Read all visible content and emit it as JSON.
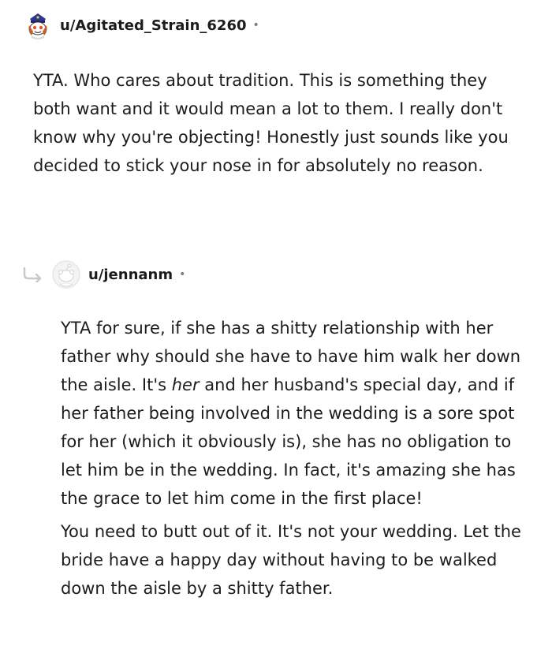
{
  "comments": [
    {
      "username": "u/Agitated_Strain_6260",
      "separator": "•",
      "paragraphs": [
        "YTA. Who cares about tradition. This is something they both want and it would mean a lot to them. I really don't know why you're objecting! Honestly just sounds like you decided to stick your nose in for absolutely no reason."
      ]
    },
    {
      "username": "u/jennanm",
      "separator": "•",
      "paragraph1_before": "YTA for sure, if she has a shitty relationship with her father why should she have to have him walk her down the aisle. It's ",
      "paragraph1_emphasis": "her",
      "paragraph1_after": " and her husband's special day, and if her father being involved in the wedding is a sore spot for her (which it obviously is), she has no obligation to let him be in the wedding. In fact, it's amazing she has the grace to let him come in the first place!",
      "paragraph2": "You need to butt out of it. It's not your wedding. Let the bride have a happy day without having to be walked down the aisle by a shitty father."
    }
  ],
  "icons": {
    "avatar1": "snoo-avatar-icon",
    "avatar2": "default-snoo-avatar-icon",
    "reply": "reply-thread-arrow-icon"
  },
  "colors": {
    "text": "#1c1c1c",
    "meta": "#7c7c7c",
    "avatar_default_bg": "#dcdcdc",
    "thread_line": "#c8c8c8"
  }
}
